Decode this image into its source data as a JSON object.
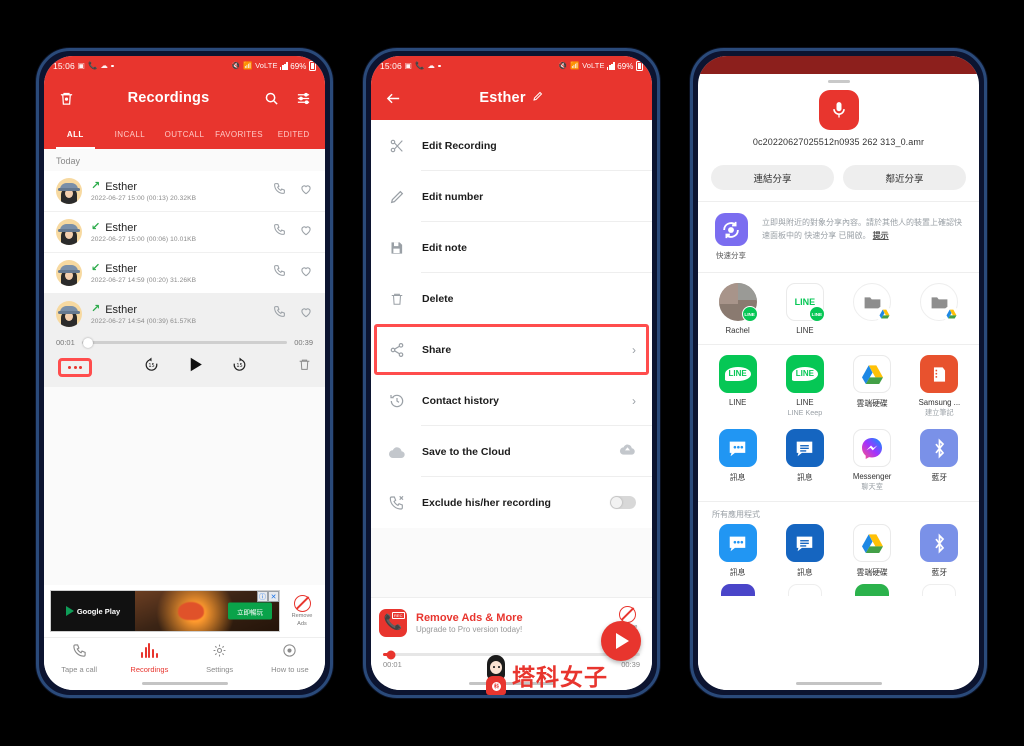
{
  "status_bar": {
    "time": "15:06",
    "battery": "69%"
  },
  "phone1": {
    "appbar": {
      "title": "Recordings",
      "trash_icon": "trash-icon",
      "search_icon": "search-icon",
      "filter_icon": "filter-icon"
    },
    "tabs": [
      {
        "label": "ALL",
        "active": true
      },
      {
        "label": "INCALL",
        "active": false
      },
      {
        "label": "OUTCALL",
        "active": false
      },
      {
        "label": "FAVORITES",
        "active": false
      },
      {
        "label": "EDITED",
        "active": false
      }
    ],
    "day_label": "Today",
    "recordings": [
      {
        "name": "Esther",
        "meta": "2022-06-27 15:00  (00:13)  20.32KB",
        "direction": "outgoing",
        "selected": false
      },
      {
        "name": "Esther",
        "meta": "2022-06-27 15:00  (00:06)  10.01KB",
        "direction": "incoming",
        "selected": false
      },
      {
        "name": "Esther",
        "meta": "2022-06-27 14:59  (00:20)  31.26KB",
        "direction": "incoming",
        "selected": false
      },
      {
        "name": "Esther",
        "meta": "2022-06-27 14:54  (00:39)  61.57KB",
        "direction": "outgoing",
        "selected": true
      }
    ],
    "player": {
      "current_time": "00:01",
      "total_time": "00:39",
      "progress_percent": 3,
      "more_button": "more-options-button",
      "rewind_label": "15",
      "forward_label": "15"
    },
    "ad": {
      "store_label": "Google Play",
      "cta": "立即暢玩",
      "remove_line1": "Remove",
      "remove_line2": "Ads"
    },
    "bottom_nav": [
      {
        "label": "Tape a call",
        "icon": "phone-icon",
        "active": false
      },
      {
        "label": "Recordings",
        "icon": "equalizer-icon",
        "active": true
      },
      {
        "label": "Settings",
        "icon": "gear-icon",
        "active": false
      },
      {
        "label": "How to use",
        "icon": "person-icon",
        "active": false
      }
    ]
  },
  "phone2": {
    "appbar": {
      "title": "Esther",
      "back_icon": "back-arrow-icon",
      "edit_icon": "pencil-icon"
    },
    "menu": [
      {
        "label": "Edit Recording",
        "icon": "scissors-icon",
        "chevron": false,
        "highlight": false
      },
      {
        "label": "Edit number",
        "icon": "pencil-icon",
        "chevron": false,
        "highlight": false
      },
      {
        "label": "Edit note",
        "icon": "note-icon",
        "chevron": false,
        "highlight": false
      },
      {
        "label": "Delete",
        "icon": "trash-icon",
        "chevron": false,
        "highlight": false
      },
      {
        "label": "Share",
        "icon": "share-icon",
        "chevron": true,
        "highlight": true
      },
      {
        "label": "Contact history",
        "icon": "history-icon",
        "chevron": true,
        "highlight": false
      },
      {
        "label": "Save to the Cloud",
        "icon": "cloud-icon",
        "chevron": false,
        "highlight": false,
        "trailing": "cloud-upload-icon"
      },
      {
        "label": "Exclude his/her recording",
        "icon": "phone-off-icon",
        "chevron": false,
        "highlight": false,
        "toggle": true
      }
    ],
    "promo": {
      "title": "Remove Ads & More",
      "subtitle": "Upgrade to Pro version today!",
      "remove_line1": "Remove",
      "remove_line2": "Ads"
    },
    "player": {
      "current_time": "00:01",
      "total_time": "00:39",
      "progress_percent": 3,
      "fab": "play-button"
    }
  },
  "phone3": {
    "filename": "0c20220627025512n0935 262 313_0.amr",
    "mic_icon": "microphone-icon",
    "share_buttons": [
      {
        "label": "連結分享"
      },
      {
        "label": "鄰近分享"
      }
    ],
    "quick_share": {
      "icon_label": "快速分享",
      "description": "立即與附近的對象分享內容。請於其他人的裝置上確認快速面板中的 快速分享 已開啟。",
      "link": "提示"
    },
    "contacts_row": [
      {
        "name": "Rachel",
        "type": "contact",
        "badge": "LINE"
      },
      {
        "name": "LINE",
        "type": "line",
        "badge": "LINE"
      },
      {
        "name": "",
        "type": "folder-drive",
        "badge": ""
      },
      {
        "name": "",
        "type": "folder-drive",
        "badge": ""
      }
    ],
    "apps_row1": [
      {
        "name": "LINE",
        "sub": "",
        "type": "line"
      },
      {
        "name": "LINE",
        "sub": "LINE Keep",
        "type": "line"
      },
      {
        "name": "雲端硬碟",
        "sub": "",
        "type": "drive"
      },
      {
        "name": "Samsung ...",
        "sub": "建立筆記",
        "type": "notes"
      }
    ],
    "apps_row2": [
      {
        "name": "訊息",
        "sub": "",
        "type": "messages-light"
      },
      {
        "name": "訊息",
        "sub": "",
        "type": "messages-dark"
      },
      {
        "name": "Messenger",
        "sub": "聊天室",
        "type": "messenger"
      },
      {
        "name": "藍牙",
        "sub": "",
        "type": "bluetooth"
      }
    ],
    "all_apps_label": "所有應用程式",
    "all_apps": [
      {
        "name": "訊息",
        "type": "messages-light"
      },
      {
        "name": "訊息",
        "type": "messages-dark"
      },
      {
        "name": "雲端硬碟",
        "type": "drive"
      },
      {
        "name": "藍牙",
        "type": "bluetooth"
      }
    ]
  },
  "watermark": {
    "text": "塔科女子",
    "badge": "科"
  },
  "colors": {
    "primary": "#e8352e",
    "highlight": "#ff4d4d",
    "green": "#2bab4a",
    "line_green": "#06c755"
  }
}
